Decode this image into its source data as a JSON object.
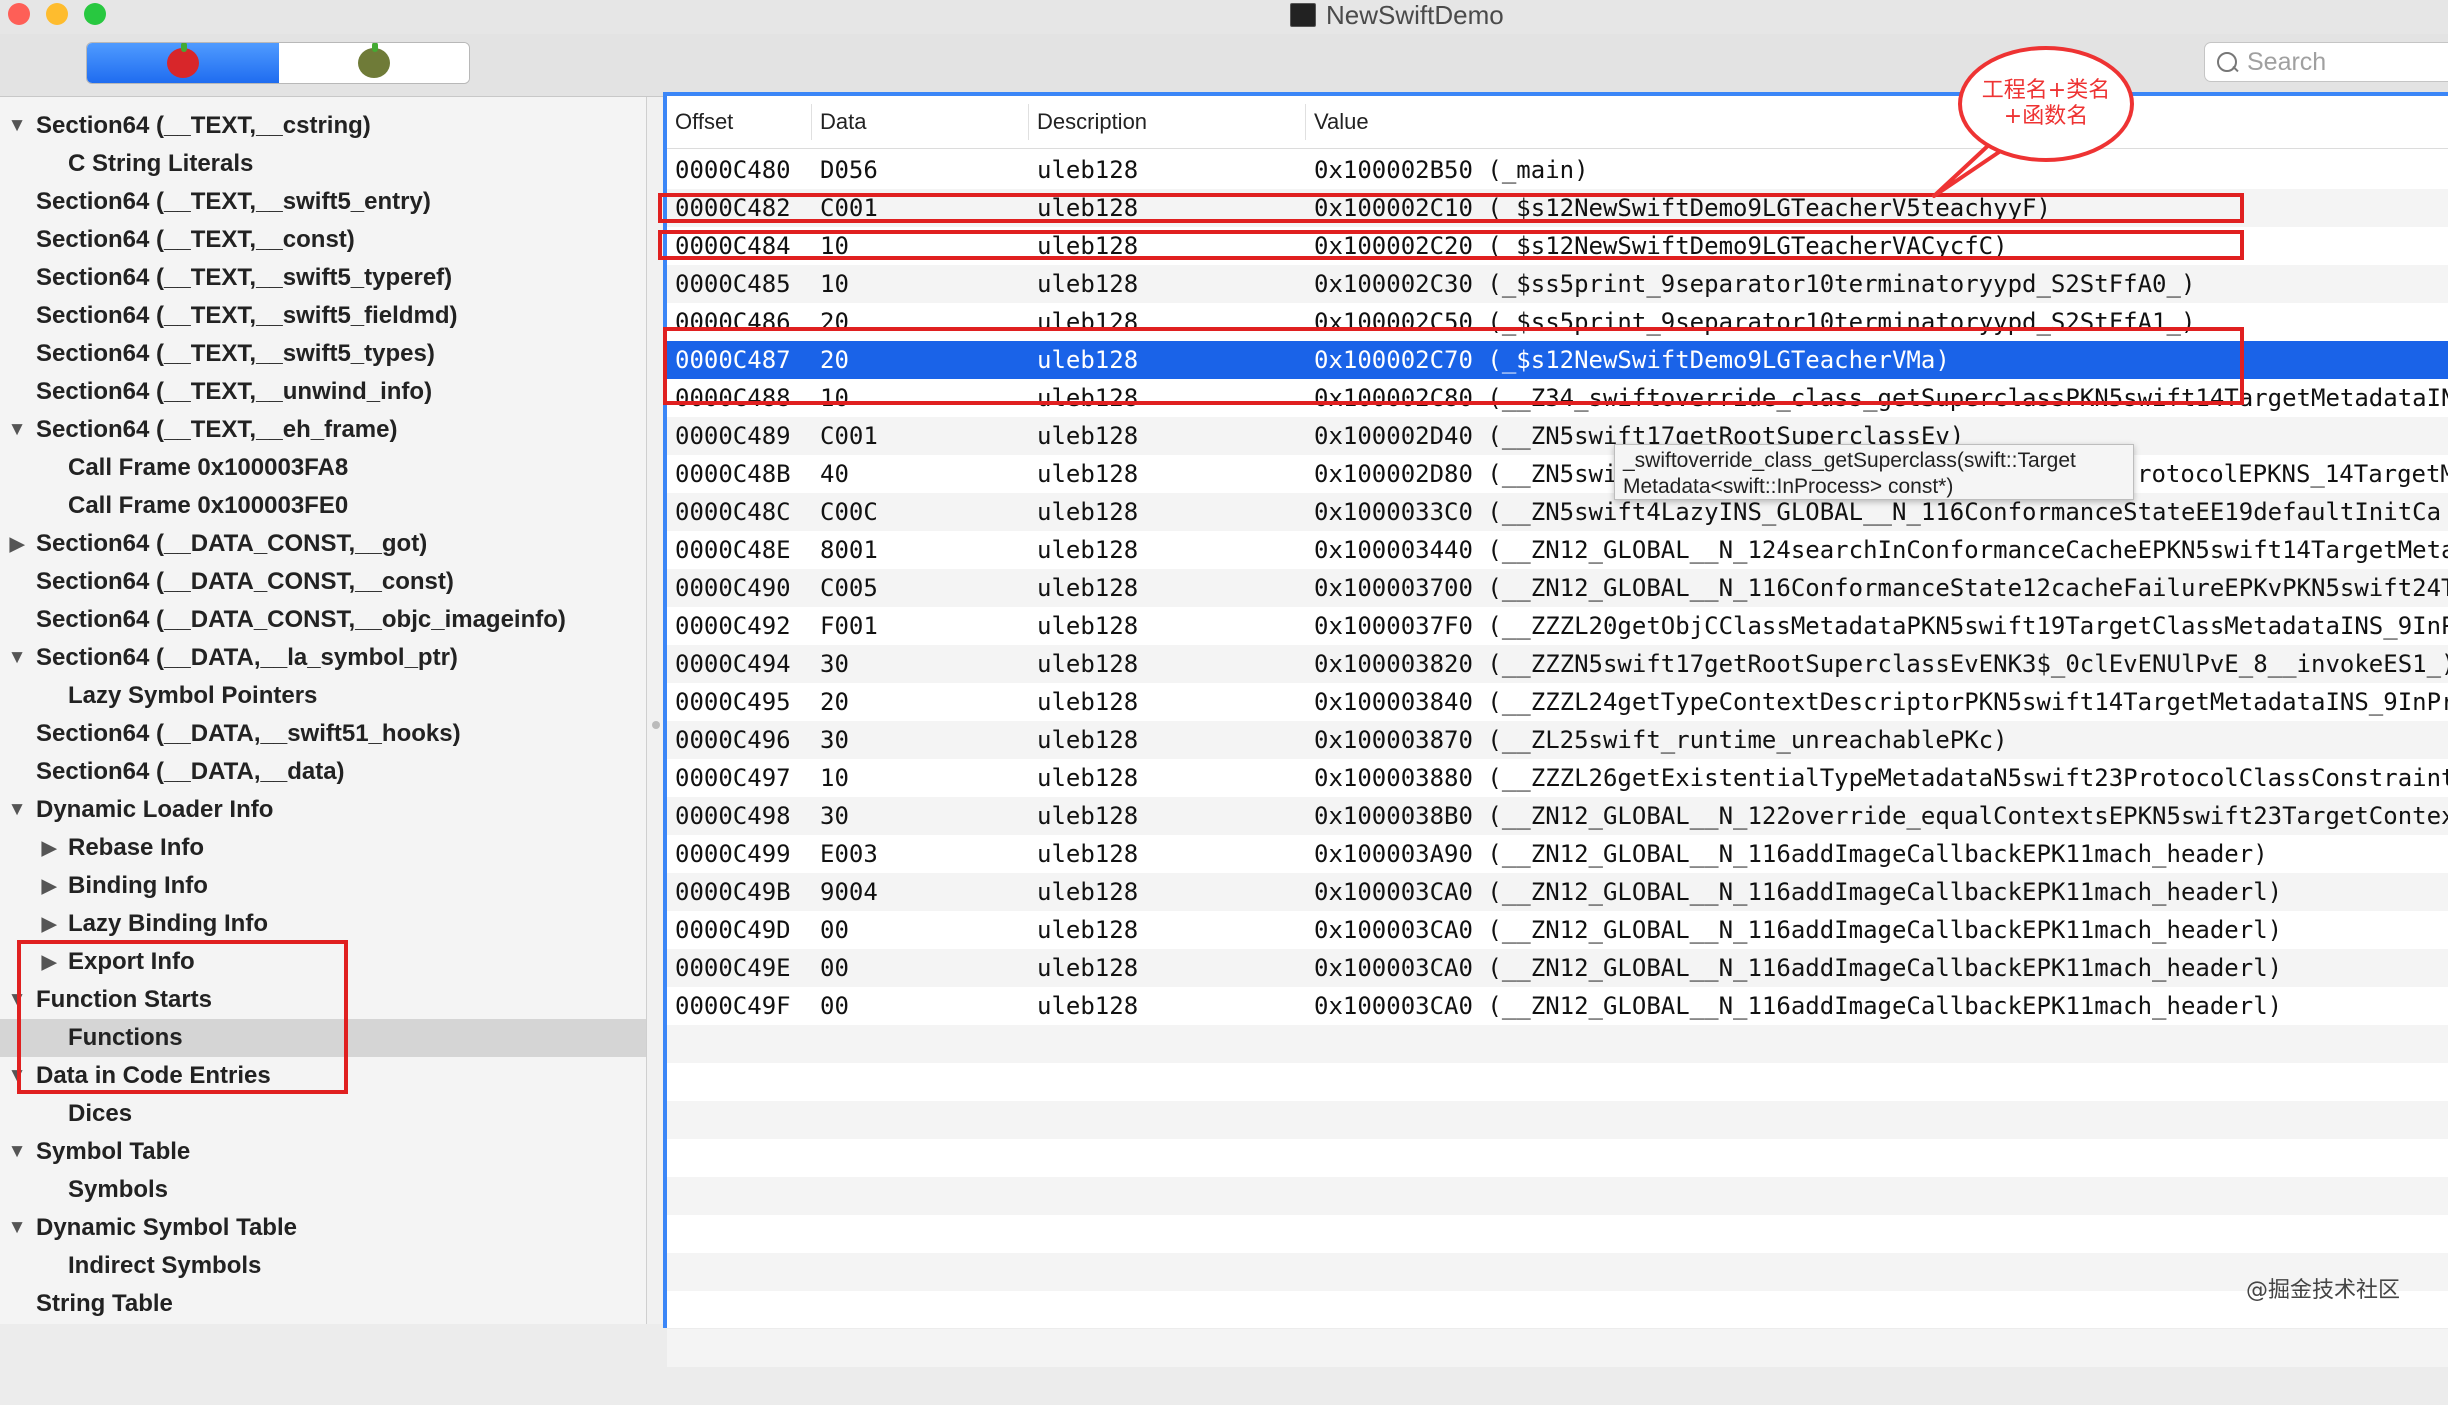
{
  "window": {
    "title": "NewSwiftDemo"
  },
  "toolbar": {
    "search_placeholder": "Search"
  },
  "sidebar": {
    "items": [
      {
        "label": "Section64 (__TEXT,__cstring)",
        "level": 0,
        "expander": "expanded"
      },
      {
        "label": "C String Literals",
        "level": 1,
        "expander": "none"
      },
      {
        "label": "Section64 (__TEXT,__swift5_entry)",
        "level": 0,
        "expander": "none"
      },
      {
        "label": "Section64 (__TEXT,__const)",
        "level": 0,
        "expander": "none"
      },
      {
        "label": "Section64 (__TEXT,__swift5_typeref)",
        "level": 0,
        "expander": "none"
      },
      {
        "label": "Section64 (__TEXT,__swift5_fieldmd)",
        "level": 0,
        "expander": "none"
      },
      {
        "label": "Section64 (__TEXT,__swift5_types)",
        "level": 0,
        "expander": "none"
      },
      {
        "label": "Section64 (__TEXT,__unwind_info)",
        "level": 0,
        "expander": "none"
      },
      {
        "label": "Section64 (__TEXT,__eh_frame)",
        "level": 0,
        "expander": "expanded"
      },
      {
        "label": "Call Frame 0x100003FA8",
        "level": 1,
        "expander": "none"
      },
      {
        "label": "Call Frame 0x100003FE0",
        "level": 1,
        "expander": "none"
      },
      {
        "label": "Section64 (__DATA_CONST,__got)",
        "level": 0,
        "expander": "collapsed"
      },
      {
        "label": "Section64 (__DATA_CONST,__const)",
        "level": 0,
        "expander": "none"
      },
      {
        "label": "Section64 (__DATA_CONST,__objc_imageinfo)",
        "level": 0,
        "expander": "none"
      },
      {
        "label": "Section64 (__DATA,__la_symbol_ptr)",
        "level": 0,
        "expander": "expanded"
      },
      {
        "label": "Lazy Symbol Pointers",
        "level": 1,
        "expander": "none"
      },
      {
        "label": "Section64 (__DATA,__swift51_hooks)",
        "level": 0,
        "expander": "none"
      },
      {
        "label": "Section64 (__DATA,__data)",
        "level": 0,
        "expander": "none"
      },
      {
        "label": "Dynamic Loader Info",
        "level": 0,
        "expander": "expanded"
      },
      {
        "label": "Rebase Info",
        "level": 1,
        "expander": "collapsed"
      },
      {
        "label": "Binding Info",
        "level": 1,
        "expander": "collapsed"
      },
      {
        "label": "Lazy Binding Info",
        "level": 1,
        "expander": "collapsed"
      },
      {
        "label": "Export Info",
        "level": 1,
        "expander": "collapsed"
      },
      {
        "label": "Function Starts",
        "level": 0,
        "expander": "expanded"
      },
      {
        "label": "Functions",
        "level": 1,
        "expander": "none",
        "selected": true
      },
      {
        "label": "Data in Code Entries",
        "level": 0,
        "expander": "expanded"
      },
      {
        "label": "Dices",
        "level": 1,
        "expander": "none"
      },
      {
        "label": "Symbol Table",
        "level": 0,
        "expander": "expanded"
      },
      {
        "label": "Symbols",
        "level": 1,
        "expander": "none"
      },
      {
        "label": "Dynamic Symbol Table",
        "level": 0,
        "expander": "expanded"
      },
      {
        "label": "Indirect Symbols",
        "level": 1,
        "expander": "none"
      },
      {
        "label": "String Table",
        "level": 0,
        "expander": "none"
      }
    ]
  },
  "table": {
    "headers": {
      "offset": "Offset",
      "data": "Data",
      "description": "Description",
      "value": "Value"
    },
    "rows": [
      {
        "offset": "0000C480",
        "data": "D056",
        "description": "uleb128",
        "value": "0x100002B50 (_main)"
      },
      {
        "offset": "0000C482",
        "data": "C001",
        "description": "uleb128",
        "value": "0x100002C10 (_$s12NewSwiftDemo9LGTeacherV5teachyyF)"
      },
      {
        "offset": "0000C484",
        "data": "10",
        "description": "uleb128",
        "value": "0x100002C20 (_$s12NewSwiftDemo9LGTeacherVACycfC)"
      },
      {
        "offset": "0000C485",
        "data": "10",
        "description": "uleb128",
        "value": "0x100002C30 (_$ss5print_9separator10terminatoryypd_S2StFfA0_)"
      },
      {
        "offset": "0000C486",
        "data": "20",
        "description": "uleb128",
        "value": "0x100002C50 (_$ss5print_9separator10terminatoryypd_S2StFfA1_)"
      },
      {
        "offset": "0000C487",
        "data": "20",
        "description": "uleb128",
        "value": "0x100002C70 (_$s12NewSwiftDemo9LGTeacherVMa)",
        "selected": true
      },
      {
        "offset": "0000C488",
        "data": "10",
        "description": "uleb128",
        "value": "0x100002C80 (__Z34_swiftoverride_class_getSuperclassPKN5swift14TargetMetadataIN"
      },
      {
        "offset": "0000C489",
        "data": "C001",
        "description": "uleb128",
        "value": "0x100002D40 (__ZN5swift17getRootSuperclassEv)"
      },
      {
        "offset": "0000C48B",
        "data": "40",
        "description": "uleb128",
        "value": "0x100002D80 (__ZN5swi"
      },
      {
        "offset": "0000C48C",
        "data": "C00C",
        "description": "uleb128",
        "value": "0x1000033C0 (__ZN5swift4LazyINS_GLOBAL__N_116ConformanceStateEE19defaultInitCa"
      },
      {
        "offset": "0000C48E",
        "data": "8001",
        "description": "uleb128",
        "value": "0x100003440 (__ZN12_GLOBAL__N_124searchInConformanceCacheEPKN5swift14TargetMeta"
      },
      {
        "offset": "0000C490",
        "data": "C005",
        "description": "uleb128",
        "value": "0x100003700 (__ZN12_GLOBAL__N_116ConformanceState12cacheFailureEPKvPKN5swift24T"
      },
      {
        "offset": "0000C492",
        "data": "F001",
        "description": "uleb128",
        "value": "0x1000037F0 (__ZZZL20getObjCClassMetadataPKN5swift19TargetClassMetadataINS_9InP"
      },
      {
        "offset": "0000C494",
        "data": "30",
        "description": "uleb128",
        "value": "0x100003820 (__ZZZN5swift17getRootSuperclassEvENK3$_0clEvENUlPvE_8__invokeES1_)"
      },
      {
        "offset": "0000C495",
        "data": "20",
        "description": "uleb128",
        "value": "0x100003840 (__ZZZL24getTypeContextDescriptorPKN5swift14TargetMetadataINS_9InPr"
      },
      {
        "offset": "0000C496",
        "data": "30",
        "description": "uleb128",
        "value": "0x100003870 (__ZL25swift_runtime_unreachablePKc)"
      },
      {
        "offset": "0000C497",
        "data": "10",
        "description": "uleb128",
        "value": "0x100003880 (__ZZZL26getExistentialTypeMetadataN5swift23ProtocolClassConstraint"
      },
      {
        "offset": "0000C498",
        "data": "30",
        "description": "uleb128",
        "value": "0x1000038B0 (__ZN12_GLOBAL__N_122override_equalContextsEPKN5swift23TargetContex"
      },
      {
        "offset": "0000C499",
        "data": "E003",
        "description": "uleb128",
        "value": "0x100003A90 (__ZN12_GLOBAL__N_116addImageCallbackEPK11mach_header)"
      },
      {
        "offset": "0000C49B",
        "data": "9004",
        "description": "uleb128",
        "value": "0x100003CA0 (__ZN12_GLOBAL__N_116addImageCallbackEPK11mach_headerl)"
      },
      {
        "offset": "0000C49D",
        "data": "00",
        "description": "uleb128",
        "value": "0x100003CA0 (__ZN12_GLOBAL__N_116addImageCallbackEPK11mach_headerl)"
      },
      {
        "offset": "0000C49E",
        "data": "00",
        "description": "uleb128",
        "value": "0x100003CA0 (__ZN12_GLOBAL__N_116addImageCallbackEPK11mach_headerl)"
      },
      {
        "offset": "0000C49F",
        "data": "00",
        "description": "uleb128",
        "value": "0x100003CA0 (__ZN12_GLOBAL__N_116addImageCallbackEPK11mach_headerl)"
      }
    ]
  },
  "tooltip": {
    "line1": "_swiftoverride_class_getSuperclass(swift::Target",
    "line2": "Metadata<swift::InProcess> const*)",
    "value_tail": "rotocolEPKNS_14TargetM"
  },
  "annotation": {
    "line1": "工程名+类名",
    "line2": "+函数名"
  },
  "watermark": "@掘金技术社区",
  "colors": {
    "accent": "#1a63e8",
    "highlight_box": "#e02020",
    "callout": "#e33333"
  }
}
